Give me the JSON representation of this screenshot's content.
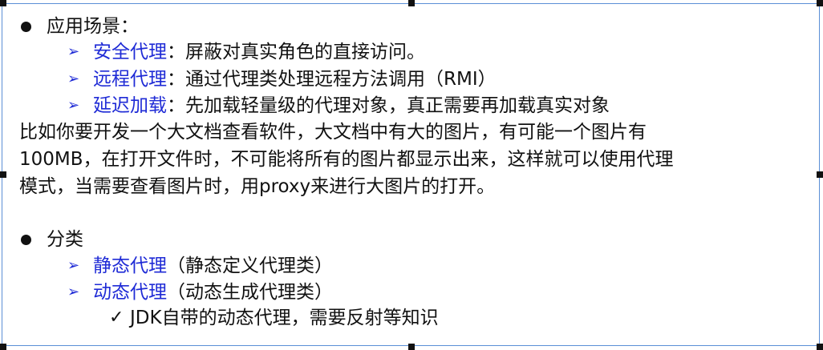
{
  "section1": {
    "heading": "应用场景：",
    "items": [
      {
        "term": "安全代理",
        "desc": "：屏蔽对真实角色的直接访问。"
      },
      {
        "term": "远程代理",
        "desc": "：通过代理类处理远程方法调用（RMI）"
      },
      {
        "term": "延迟加载",
        "desc": "：先加载轻量级的代理对象，真正需要再加载真实对象"
      }
    ],
    "paragraph": [
      "比如你要开发一个大文档查看软件，大文档中有大的图片，有可能一个图片有",
      "100MB，在打开文件时，不可能将所有的图片都显示出来，这样就可以使用代理",
      "模式，当需要查看图片时，用proxy来进行大图片的打开。"
    ]
  },
  "section2": {
    "heading": "分类",
    "items": [
      {
        "term": "静态代理",
        "desc": "（静态定义代理类）"
      },
      {
        "term": "动态代理",
        "desc": "（动态生成代理类）"
      }
    ],
    "subitem": "JDK自带的动态代理，需要反射等知识"
  },
  "icons": {
    "bullet": "filled-circle-bullet",
    "arrow": "arrow-bullet",
    "check": "check-bullet"
  },
  "colors": {
    "accent": "#1f2bd6",
    "frame": "#5b8fd6",
    "text": "#111111"
  }
}
